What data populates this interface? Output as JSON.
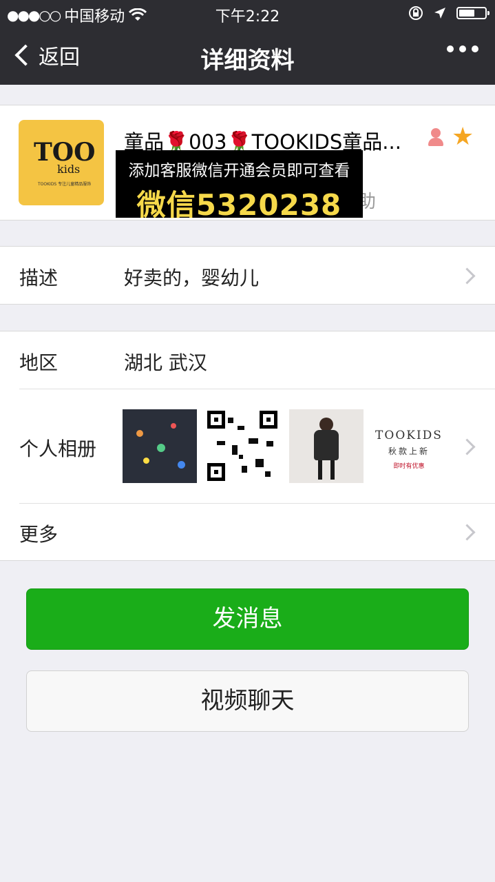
{
  "status_bar": {
    "signal": "●●●○○",
    "carrier": "中国移动",
    "time": "下午2:22"
  },
  "nav": {
    "back_label": "返回",
    "title": "详细资料"
  },
  "profile": {
    "name_part1": "童品",
    "name_rose1": "🌹",
    "name_part2": "003",
    "name_rose2": "🌹",
    "name_part3": "TOOKIDS童品...",
    "avatar_logo": "TOO",
    "avatar_kids": "kids",
    "avatar_tag": "TOOKIDS 专注儿童精品服饰",
    "partial_subtext": "助"
  },
  "promo": {
    "line1": "添加客服微信开通会员即可查看",
    "line2": "微信5320238"
  },
  "rows": {
    "description": {
      "label": "描述",
      "value": "好卖的，婴幼儿"
    },
    "region": {
      "label": "地区",
      "value": "湖北 武汉"
    },
    "album": {
      "label": "个人相册"
    },
    "more": {
      "label": "更多"
    }
  },
  "album_thumb4": {
    "brand": "TOOKIDS",
    "sub1": "秋款上新",
    "sub2": "即时有优惠"
  },
  "buttons": {
    "send_message": "发消息",
    "video_chat": "视频聊天"
  },
  "colors": {
    "nav_bg": "#2d2d32",
    "primary_green": "#1aad19",
    "page_bg": "#efeff4"
  }
}
